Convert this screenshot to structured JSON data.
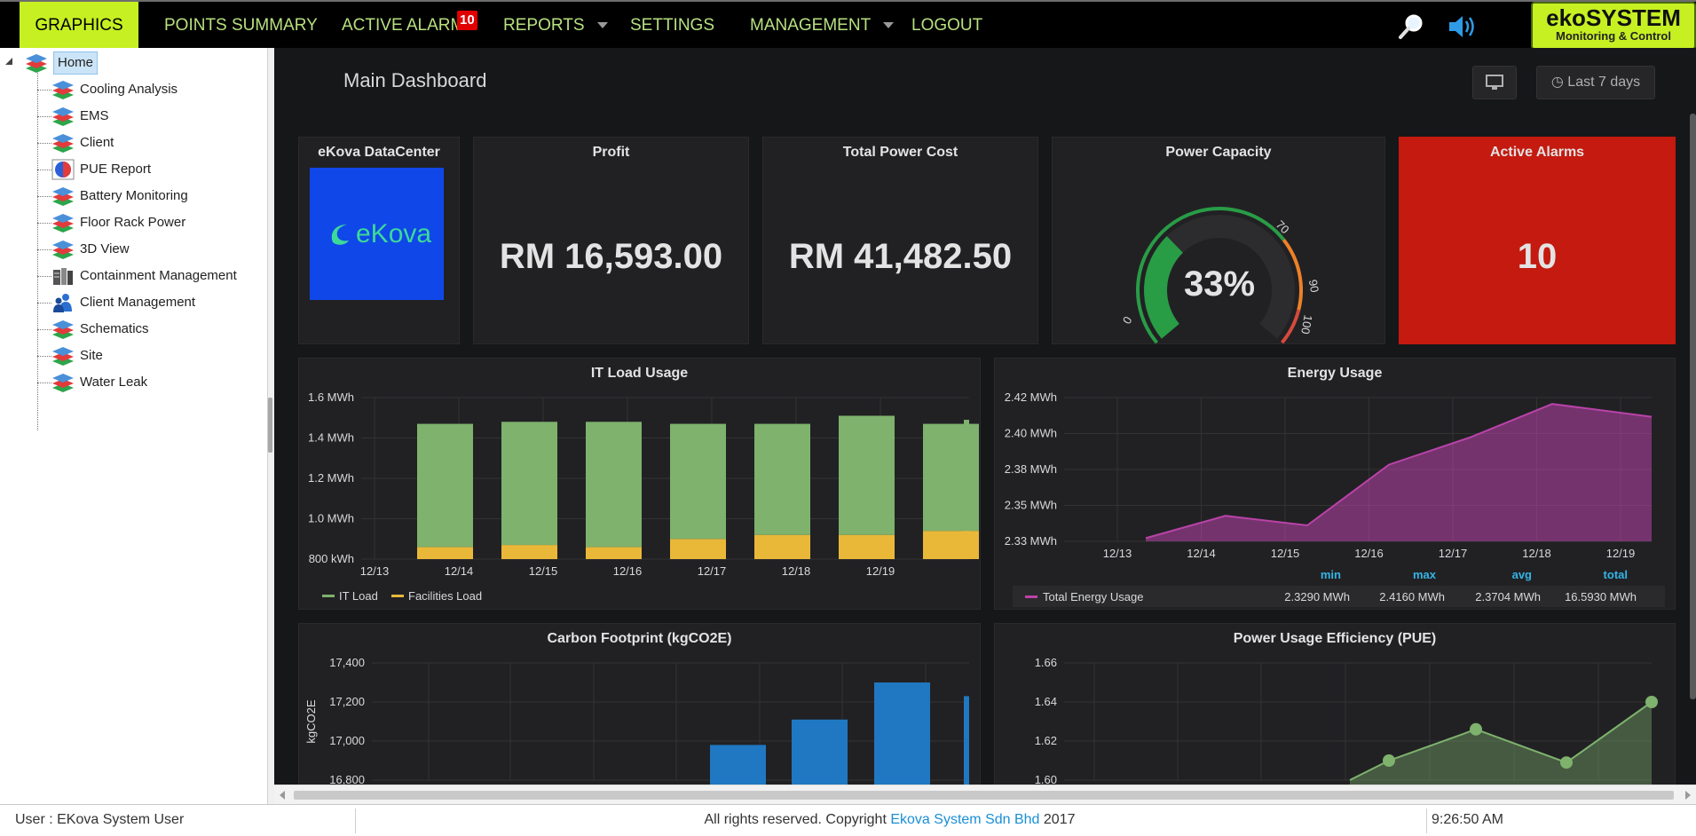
{
  "nav": {
    "items": [
      {
        "label": "GRAPHICS",
        "active": true
      },
      {
        "label": "POINTS SUMMARY",
        "active": false
      },
      {
        "label": "ACTIVE ALARMS",
        "active": false
      },
      {
        "label": "REPORTS",
        "active": false
      },
      {
        "label": "SETTINGS",
        "active": false
      },
      {
        "label": "MANAGEMENT",
        "active": false
      },
      {
        "label": "LOGOUT",
        "active": false
      }
    ],
    "alarm_badge": "10",
    "logo_line1": "ekoSYSTEM",
    "logo_line2": "Monitoring & Control",
    "accent_color": "#c6f022"
  },
  "tree": {
    "items": [
      {
        "label": "Home",
        "icon": "layers-icon"
      },
      {
        "label": "Cooling Analysis",
        "icon": "layers-icon"
      },
      {
        "label": "EMS",
        "icon": "layers-icon"
      },
      {
        "label": "Client",
        "icon": "layers-icon"
      },
      {
        "label": "PUE Report",
        "icon": "pie-icon"
      },
      {
        "label": "Battery Monitoring",
        "icon": "layers-icon"
      },
      {
        "label": "Floor Rack Power",
        "icon": "layers-icon"
      },
      {
        "label": "3D View",
        "icon": "layers-icon"
      },
      {
        "label": "Containment Management",
        "icon": "server-rack-icon"
      },
      {
        "label": "Client Management",
        "icon": "users-icon"
      },
      {
        "label": "Schematics",
        "icon": "layers-icon"
      },
      {
        "label": "Site",
        "icon": "layers-icon"
      },
      {
        "label": "Water Leak",
        "icon": "layers-icon"
      }
    ]
  },
  "dashboard": {
    "title": "Main Dashboard",
    "time_range": "Last 7 days",
    "datacenter": {
      "title": "eKova DataCenter",
      "logo_text": "eKova"
    },
    "profit": {
      "title": "Profit",
      "value": "RM 16,593.00"
    },
    "power_cost": {
      "title": "Total Power Cost",
      "value": "RM 41,482.50"
    },
    "power_capacity": {
      "title": "Power Capacity",
      "value": "33%",
      "percent": 33,
      "ticks": [
        "0",
        "70",
        "90",
        "100"
      ]
    },
    "active_alarms": {
      "title": "Active Alarms",
      "value": "10",
      "color": "#c41a0f"
    }
  },
  "chart_data": [
    {
      "type": "bar",
      "title": "IT Load Usage",
      "stacked": true,
      "categories": [
        "12/13",
        "12/14",
        "12/15",
        "12/16",
        "12/17",
        "12/18",
        "12/19"
      ],
      "yticks": [
        "800 kWh",
        "1.0 MWh",
        "1.2 MWh",
        "1.4 MWh",
        "1.6 MWh"
      ],
      "ylim": [
        0.8,
        1.6
      ],
      "series": [
        {
          "name": "Facilities Load",
          "color": "#eab839",
          "values": [
            0.86,
            0.87,
            0.86,
            0.9,
            0.92,
            0.92,
            0.94
          ]
        },
        {
          "name": "IT Load",
          "color": "#7eb26d",
          "values": [
            0.61,
            0.61,
            0.62,
            0.57,
            0.55,
            0.59,
            0.53
          ]
        }
      ]
    },
    {
      "type": "area",
      "title": "Energy Usage",
      "categories": [
        "12/13",
        "12/14",
        "12/15",
        "12/16",
        "12/17",
        "12/18",
        "12/19"
      ],
      "yticks": [
        "2.33 MWh",
        "2.35 MWh",
        "2.38 MWh",
        "2.40 MWh",
        "2.42 MWh"
      ],
      "ylim": [
        2.33,
        2.42
      ],
      "series": [
        {
          "name": "Total Energy Usage",
          "color": "#ba43a9",
          "values": [
            2.332,
            2.346,
            2.34,
            2.378,
            2.395,
            2.416,
            2.408
          ]
        }
      ],
      "legend_headers": [
        "min",
        "max",
        "avg",
        "total"
      ],
      "legend_values": [
        "2.3290 MWh",
        "2.4160 MWh",
        "2.3704 MWh",
        "16.5930 MWh"
      ]
    },
    {
      "type": "bar",
      "title": "Carbon Footprint (kgCO2E)",
      "ylabel": "kgCO2E",
      "yticks": [
        "16,800",
        "17,000",
        "17,200",
        "17,400"
      ],
      "ylim": [
        16800,
        17400
      ],
      "series": [
        {
          "name": "",
          "color": "#1f78c1",
          "values": [
            16980,
            17110,
            17300,
            17230
          ]
        }
      ]
    },
    {
      "type": "area",
      "title": "Power Usage Efficiency (PUE)",
      "yticks": [
        "1.60",
        "1.62",
        "1.64",
        "1.66"
      ],
      "ylim": [
        1.6,
        1.66
      ],
      "series": [
        {
          "name": "",
          "color": "#7eb26d",
          "values": [
            1.6,
            1.61,
            1.626,
            1.609,
            1.64
          ]
        }
      ]
    }
  ],
  "status": {
    "user": "User : EKova System User",
    "copyright_prefix": "All rights reserved. Copyright",
    "copyright_company": "Ekova System Sdn Bhd",
    "copyright_year": "2017",
    "time": "9:26:50 AM"
  }
}
